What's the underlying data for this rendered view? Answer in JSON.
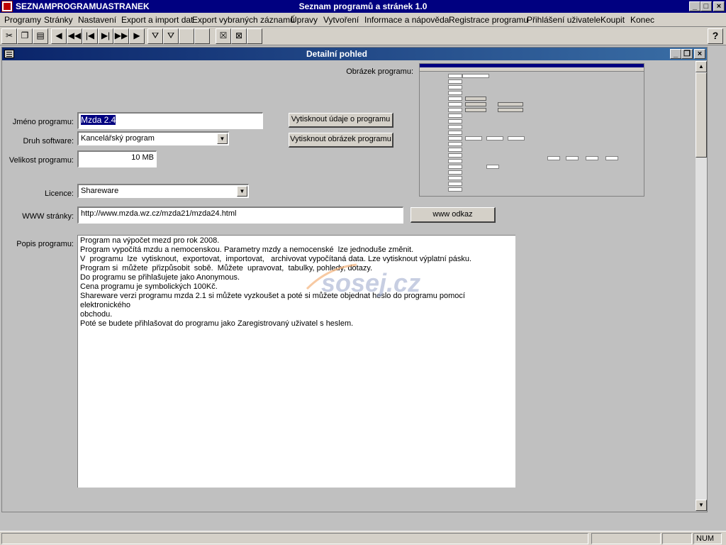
{
  "app": {
    "name": "SEZNAMPROGRAMUASTRANEK",
    "title": "Seznam programů a stránek 1.0"
  },
  "menu": [
    "Programy",
    "Stránky",
    "Nastavení",
    "Export a import dat",
    "Export vybraných záznamů",
    "Úpravy",
    "Vytvoření",
    "Informace a nápověda",
    "Registrace programu",
    "Přihlášení uživatele",
    "Koupit",
    "Konec"
  ],
  "toolbar": {
    "icons": [
      "scissors-icon",
      "copy-icon",
      "paste-icon",
      "prev-icon",
      "rewind-icon",
      "first-icon",
      "last-icon",
      "fast-forward-icon",
      "next-icon",
      "filter-icon",
      "filter-edit-icon",
      "blank-1",
      "blank-2",
      "crossed-icon",
      "crossed-box-icon",
      "blank-3"
    ],
    "help_label": "?"
  },
  "child": {
    "title": "Detailní pohled"
  },
  "form": {
    "image_label": "Obrázek programu:",
    "name_label": "Jméno programu:",
    "name_value": "Mzda 2.4",
    "type_label": "Druh software:",
    "type_value": "Kancelářský program",
    "size_label": "Velikost programu:",
    "size_value": "10 MB",
    "license_label": "Licence:",
    "license_value": "Shareware",
    "www_label": "WWW stránky:",
    "www_value": "http://www.mzda.wz.cz/mzda21/mzda24.html",
    "desc_label": "Popis programu:",
    "description": [
      "Program na výpočet mezd pro rok 2008.",
      "Program vypočítá mzdu a nemocenskou. Parametry mzdy a nemocenské  lze jednoduše změnit.",
      "V  programu  lze  vytisknout,  exportovat,  importovat,   archivovat vypočítaná data. Lze vytisknout výplatní pásku.",
      "Program si  můžete  přizpůsobit  sobě.  Můžete  upravovat,  tabulky, pohledy, dotazy.",
      "Do programu se přihlašujete jako Anonymous.",
      "Cena programu je symbolických 100Kč.",
      "Shareware verzi programu mzda 2.1 si můžete vyzkoušet a poté si můžete objednat heslo do programu pomocí elektronického",
      "obchodu.",
      "Poté se budete přihlašovat do programu jako Zaregistrovaný uživatel s heslem."
    ],
    "print_info_btn": "Vytisknout údaje o programu",
    "print_image_btn": "Vytisknout obrázek programu",
    "www_btn": "www odkaz"
  },
  "watermark": "sosej.cz",
  "statusbar": {
    "num": "NUM"
  }
}
